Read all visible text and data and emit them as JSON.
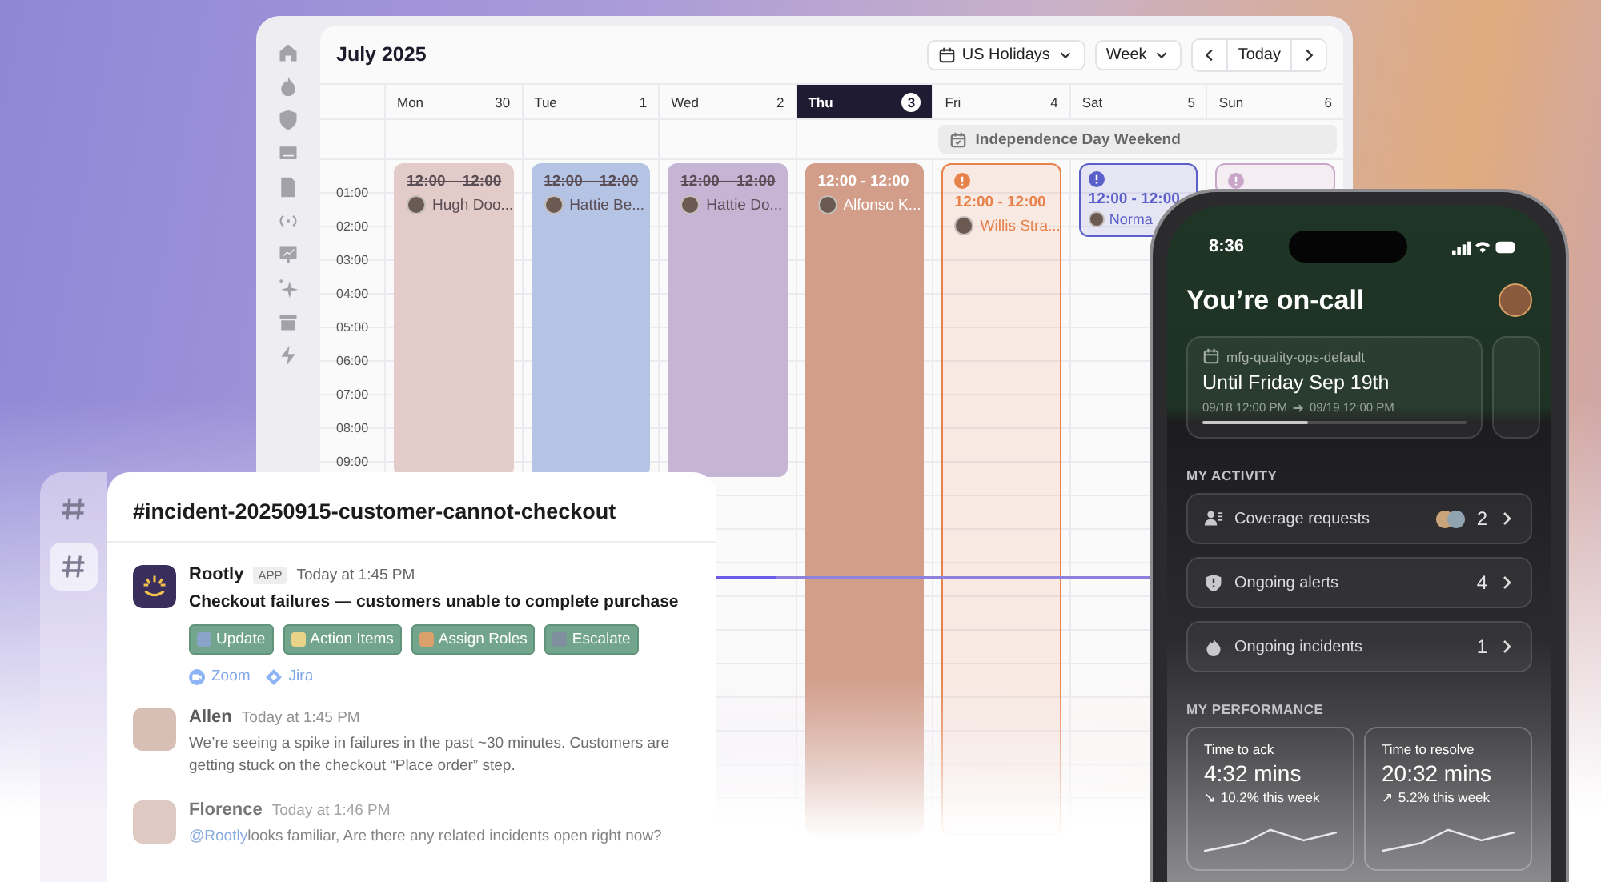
{
  "calendar": {
    "title": "July 2025",
    "calendar_filter": "US Holidays",
    "view": "Week",
    "today_button": "Today",
    "days": [
      {
        "name": "Mon",
        "date": "30",
        "selected": false
      },
      {
        "name": "Tue",
        "date": "1",
        "selected": false
      },
      {
        "name": "Wed",
        "date": "2",
        "selected": false
      },
      {
        "name": "Thu",
        "date": "3",
        "selected": true
      },
      {
        "name": "Fri",
        "date": "4",
        "selected": false
      },
      {
        "name": "Sat",
        "date": "5",
        "selected": false
      },
      {
        "name": "Sun",
        "date": "6",
        "selected": false
      }
    ],
    "all_day_event": "Independence Day Weekend",
    "hours": [
      "01:00",
      "02:00",
      "03:00",
      "04:00",
      "05:00",
      "06:00",
      "07:00",
      "08:00",
      "09:00"
    ],
    "events": [
      {
        "kind": "past",
        "color": "#e3cbc9",
        "time": "12:00 – 12:00",
        "person": "Hugh Doo..."
      },
      {
        "kind": "past",
        "color": "#b5c3e4",
        "time": "12:00 – 12:00",
        "person": "Hattie Be..."
      },
      {
        "kind": "past",
        "color": "#c6b4d4",
        "time": "12:00 – 12:00",
        "person": "Hattie Do..."
      },
      {
        "kind": "current",
        "color": "#d29d89",
        "time": "12:00 - 12:00",
        "person": "Alfonso K..."
      },
      {
        "kind": "upcoming",
        "color": "#e8824b",
        "time": "12:00 - 12:00",
        "person": "Willis Stra..."
      },
      {
        "kind": "upcoming",
        "color": "#5a5fca",
        "time": "12:00 - 12:00",
        "person": "Norma"
      },
      {
        "kind": "upcoming",
        "color": "#c9a6c9"
      }
    ]
  },
  "chat": {
    "channels": [
      {
        "selected": false
      },
      {
        "selected": true
      }
    ],
    "channel_title": "#incident-20250915-customer-cannot-checkout",
    "messages": [
      {
        "kind": "bot",
        "author": "Rootly",
        "badge": "APP",
        "time": "Today at 1:45 PM",
        "text": "Checkout failures — customers unable to complete purchase",
        "actions": [
          {
            "kind": "update",
            "label": "Update"
          },
          {
            "kind": "action-items",
            "label": "Action Items"
          },
          {
            "kind": "roles",
            "label": "Assign Roles"
          },
          {
            "kind": "escalate",
            "label": "Escalate"
          }
        ],
        "links": [
          {
            "kind": "zoom",
            "label": "Zoom"
          },
          {
            "kind": "jira",
            "label": "Jira"
          }
        ]
      },
      {
        "kind": "user",
        "author": "Allen",
        "time": "Today at 1:45 PM",
        "text": "We’re seeing a spike in failures in the past ~30 minutes. Customers are getting stuck on the checkout “Place order” step."
      },
      {
        "kind": "user",
        "author": "Florence",
        "time": "Today at 1:46 PM",
        "mention": "@Rootly",
        "text": "looks familiar, Are there any related incidents open right now?"
      }
    ]
  },
  "phone": {
    "time": "8:36",
    "heading": "You’re on-call",
    "shift": {
      "schedule": "mfg-quality-ops-default",
      "until": "Until Friday Sep 19th",
      "start": "09/18 12:00 PM",
      "end": "09/19 12:00 PM",
      "level": 0.4
    },
    "activity_title": "MY ACTIVITY",
    "activity": [
      {
        "kind": "coverage",
        "label": "Coverage requests",
        "count": "2"
      },
      {
        "kind": "alerts",
        "label": "Ongoing alerts",
        "count": "4"
      },
      {
        "kind": "incidents",
        "label": "Ongoing incidents",
        "count": "1"
      }
    ],
    "performance_title": "MY PERFORMANCE",
    "performance": [
      {
        "label": "Time to ack",
        "value": "4:32 mins",
        "change": "↘ 10.2% this week"
      },
      {
        "label": "Time to resolve",
        "value": "20:32 mins",
        "change": "↗ 5.2% this week"
      }
    ]
  }
}
